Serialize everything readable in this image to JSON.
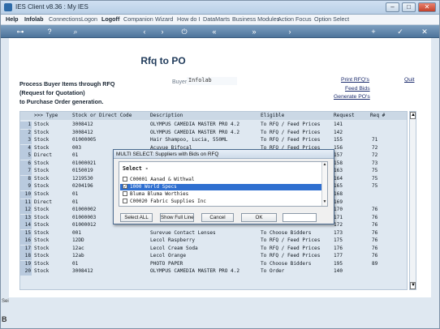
{
  "window": {
    "title": "IES Client v8.36 : My IES",
    "min": "–",
    "max": "□",
    "close": "✕"
  },
  "menu": [
    "Help",
    "Infolab",
    "Connections",
    "Logon",
    "Logoff",
    "Companion",
    "Wizard",
    "How do I",
    "DataMarts",
    "Business Modules",
    "Action Focus",
    "Option Select"
  ],
  "toolbar_icons": [
    "key-icon",
    "help-icon",
    "search-icon",
    "back-icon",
    "forward-icon",
    "power-icon",
    "rewind-icon",
    "fast-forward-icon",
    "next-icon",
    "add-icon",
    "check-icon",
    "close-icon"
  ],
  "page": {
    "title": "Rfq to PO",
    "desc_line1": "Process Buyer Items through RFQ",
    "desc_line2": "(Request for Quotation)",
    "desc_line3": "to Purchase Order generation.",
    "buyer_label": "Buyer",
    "buyer_value": "Infolab",
    "links": {
      "print_rfqs": "Print RFQ's",
      "feed_bids": "Feed Bids",
      "generate_pos": "Generate PO's",
      "quit": "Quit"
    }
  },
  "grid": {
    "headers": {
      "type": ">>> Type",
      "code": "Stock or Direct Code",
      "desc": "Description",
      "eligible": "Eligible",
      "request": "Request",
      "req": "Req #"
    },
    "rows": [
      [
        "1",
        "Stock",
        "3008412",
        "OLYMPUS CAMEDIA MASTER PRO 4.2",
        "To RFQ / Feed Prices",
        "141",
        ""
      ],
      [
        "2",
        "Stock",
        "3008412",
        "OLYMPUS CAMEDIA MASTER PRO 4.2",
        "To RFQ / Feed Prices",
        "142",
        ""
      ],
      [
        "3",
        "Stock",
        "01000005",
        "Hair Shampoo, Lucia, 550ML",
        "To RFQ / Feed Prices",
        "155",
        "71"
      ],
      [
        "4",
        "Stock",
        "003",
        "Acuvue Bifocal",
        "To RFQ / Feed Prices",
        "156",
        "72"
      ],
      [
        "5",
        "Direct",
        "01",
        "",
        "",
        "157",
        "72"
      ],
      [
        "6",
        "Stock",
        "01000021",
        "",
        "",
        "158",
        "73"
      ],
      [
        "7",
        "Stock",
        "0150019",
        "",
        "",
        "163",
        "75"
      ],
      [
        "8",
        "Stock",
        "1219530",
        "",
        "",
        "164",
        "75"
      ],
      [
        "9",
        "Stock",
        "0204196",
        "",
        "",
        "165",
        "75"
      ],
      [
        "10",
        "Stock",
        "01",
        "",
        "",
        "168",
        ""
      ],
      [
        "11",
        "Direct",
        "01",
        "",
        "",
        "169",
        ""
      ],
      [
        "12",
        "Stock",
        "01000002",
        "",
        "",
        "170",
        "76"
      ],
      [
        "13",
        "Stock",
        "01000003",
        "",
        "",
        "171",
        "76"
      ],
      [
        "14",
        "Stock",
        "01000012",
        "",
        "",
        "172",
        "76"
      ],
      [
        "15",
        "Stock",
        "001",
        "Surevue Contact Lenses",
        "To Choose Bidders",
        "173",
        "76"
      ],
      [
        "16",
        "Stock",
        "12DD",
        "Lecol Raspberry",
        "To RFQ / Feed Prices",
        "175",
        "76"
      ],
      [
        "17",
        "Stock",
        "12ac",
        "Lecol Cream Soda",
        "To RFQ / Feed Prices",
        "176",
        "76"
      ],
      [
        "18",
        "Stock",
        "12ab",
        "Lecol Orange",
        "To RFQ / Feed Prices",
        "177",
        "76"
      ],
      [
        "19",
        "Stock",
        "01",
        "PHOTO PAPER",
        "To Choose Bidders",
        "195",
        "89"
      ],
      [
        "20",
        "Stock",
        "3008412",
        "OLYMPUS CAMEDIA MASTER PRO 4.2",
        "To Order",
        "140",
        ""
      ]
    ]
  },
  "modal": {
    "title": "MULTI SELECT: Suppliers with Bids on RFQ",
    "heading": "Select -",
    "options": [
      {
        "label": "C00001 Aanad & Withwal",
        "checked": false,
        "active": false
      },
      {
        "label": "1000 World Specs",
        "checked": true,
        "active": true
      },
      {
        "label": "Bluma Bluma Worthies",
        "checked": false,
        "active": false
      },
      {
        "label": "C00020 Fabric Supplies Inc",
        "checked": false,
        "active": false
      }
    ],
    "buttons": {
      "select_all": "Select ALL",
      "show_full_line": "Show Full Line",
      "cancel": "Cancel",
      "ok": "OK"
    }
  },
  "side_strip": {
    "top": "Sei",
    "bottom": "B"
  }
}
